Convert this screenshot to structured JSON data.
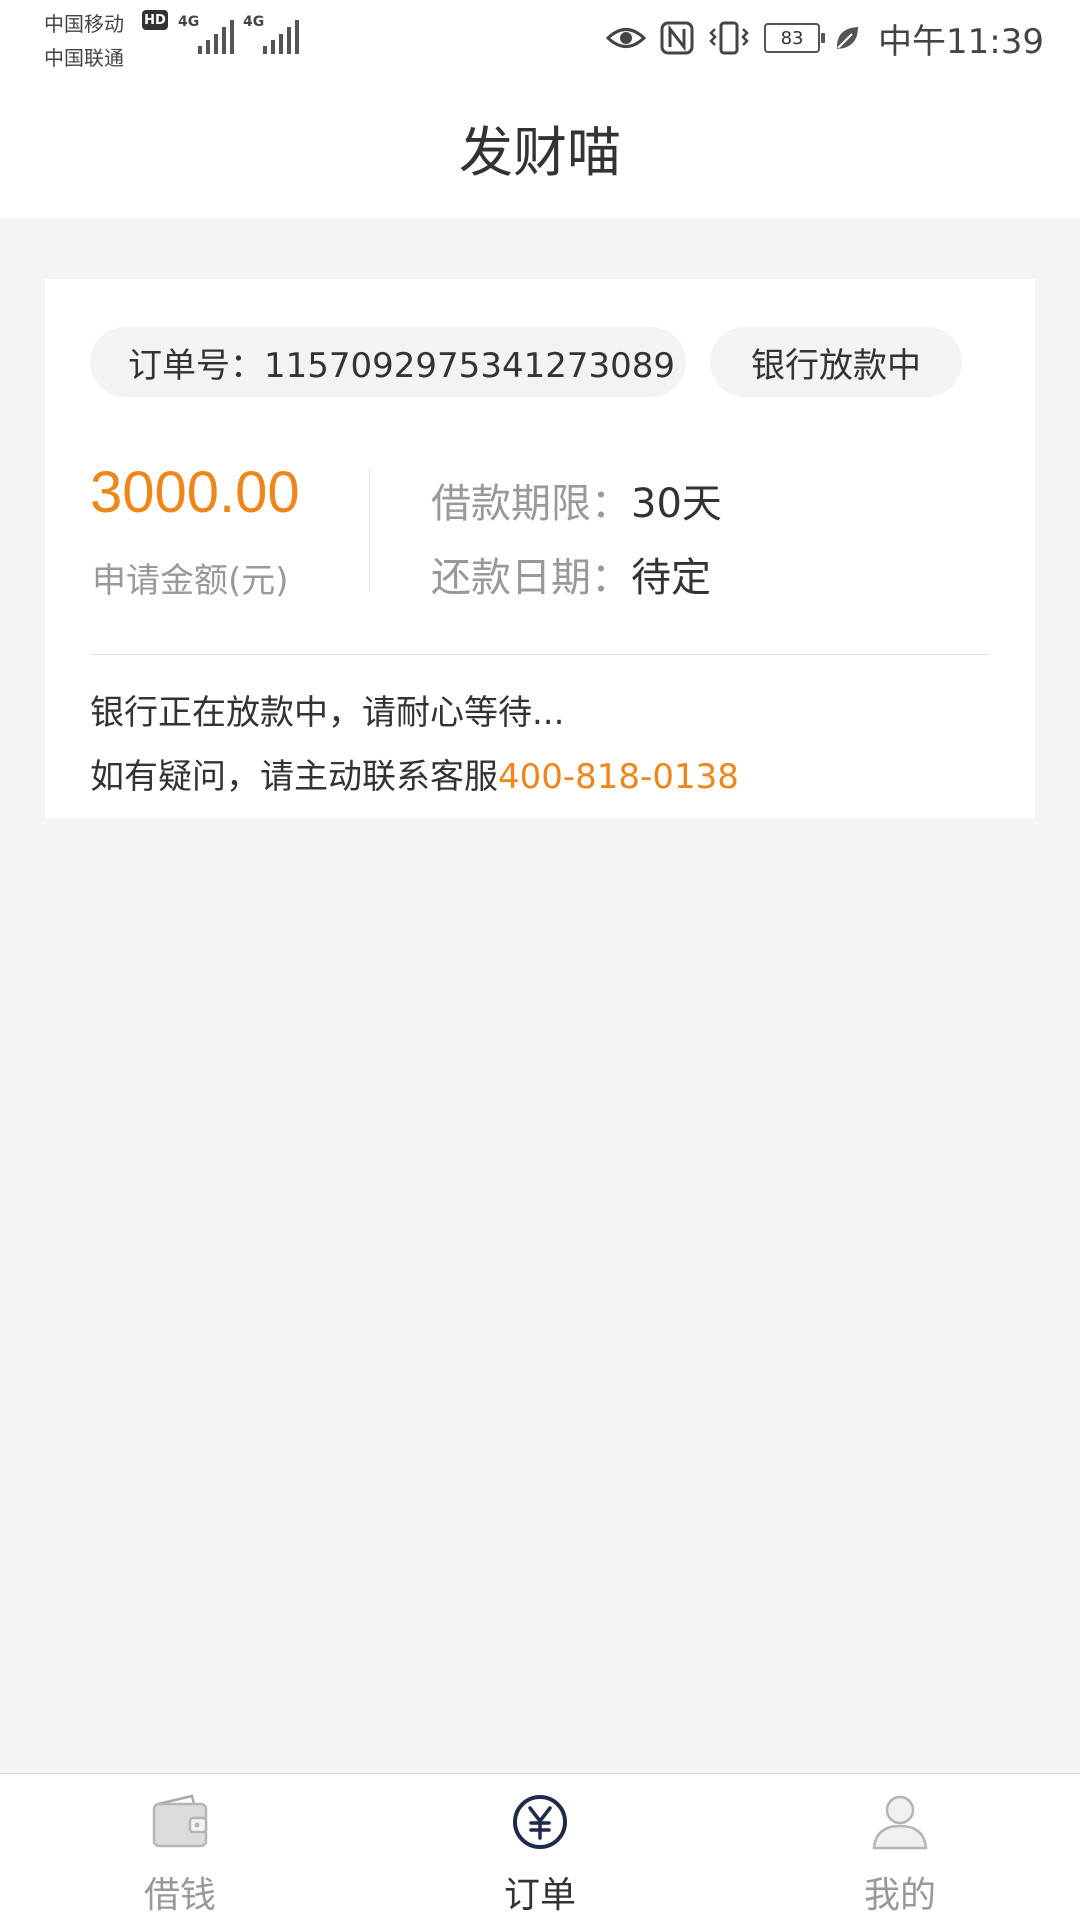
{
  "status_bar": {
    "carrier1": "中国移动",
    "carrier1_badge": "HD",
    "carrier2": "中国联通",
    "network1": "4G",
    "network2": "4G",
    "battery": "83",
    "time": "中午11:39",
    "icons": [
      "eye-icon",
      "nfc-icon",
      "vibrate-icon",
      "battery-icon",
      "leaf-icon"
    ]
  },
  "header": {
    "title": "发财喵"
  },
  "order": {
    "order_no": "订单号：1157092975341273089",
    "status": "银行放款中",
    "amount": "3000.00",
    "amount_label": "申请金额(元)",
    "term_label": "借款期限：",
    "term_value": "30天",
    "repay_label": "还款日期：",
    "repay_value": "待定",
    "message1": "银行正在放款中，请耐心等待...",
    "message2_prefix": "如有疑问，请主动联系客服",
    "phone": "400-818-0138"
  },
  "colors": {
    "accent": "#f08519",
    "tab_active": "#1f2a4a"
  },
  "tabs": [
    {
      "label": "借钱",
      "icon": "wallet-icon",
      "active": false
    },
    {
      "label": "订单",
      "icon": "yen-icon",
      "active": true
    },
    {
      "label": "我的",
      "icon": "user-icon",
      "active": false
    }
  ]
}
